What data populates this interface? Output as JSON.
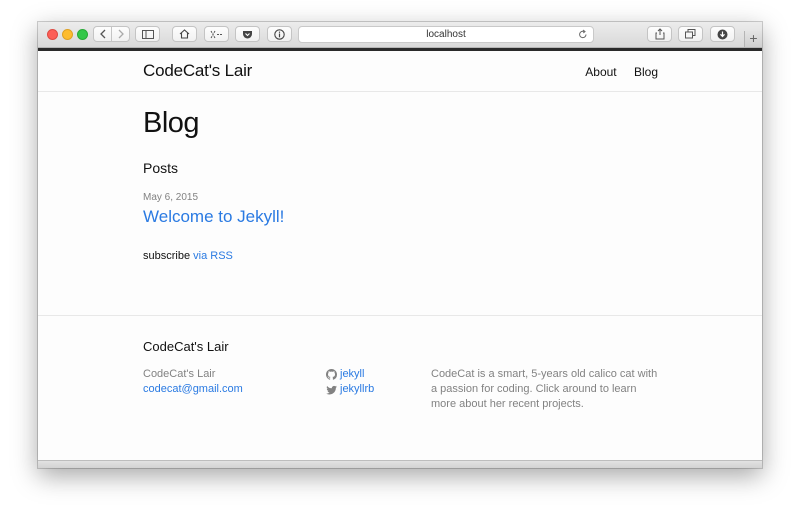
{
  "browser": {
    "url": "localhost"
  },
  "site": {
    "title": "CodeCat's Lair",
    "nav": [
      "About",
      "Blog"
    ]
  },
  "page": {
    "heading": "Blog",
    "posts_heading": "Posts",
    "post_date": "May 6, 2015",
    "post_title": "Welcome to Jekyll!",
    "subscribe_text": "subscribe",
    "rss_link": "via RSS"
  },
  "footer": {
    "heading": "CodeCat's Lair",
    "name": "CodeCat's Lair",
    "email": "codecat@gmail.com",
    "github": "jekyll",
    "twitter": "jekyllrb",
    "description": "CodeCat is a smart, 5-years old calico cat with a passion for coding. Click around to learn more about her recent projects."
  },
  "colors": {
    "link": "#2a7ae2",
    "muted": "#828282",
    "text": "#111111"
  },
  "icons": [
    "back-icon",
    "forward-icon",
    "sidebar-icon",
    "home-icon",
    "clipper-icon",
    "pocket-icon",
    "info-icon",
    "reload-icon",
    "share-icon",
    "tabs-icon",
    "download-icon",
    "new-tab-icon",
    "github-icon",
    "twitter-icon"
  ]
}
